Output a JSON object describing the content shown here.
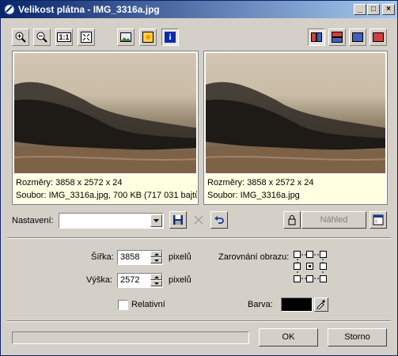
{
  "window": {
    "title": "Velikost plátna - IMG_3316a.jpg",
    "minimize": "_",
    "maximize": "□",
    "close": "×"
  },
  "toolbar": {
    "zoom_in": "zoom-in-icon",
    "zoom_out": "zoom-out-icon",
    "actual_size": "1:1",
    "fit": "fit-window-icon",
    "image": "image-icon",
    "sun": "brightness-icon",
    "info": "i",
    "layout_side": "split-vertical-icon",
    "layout_stack": "split-horizontal-icon",
    "view_original": "view-original-icon",
    "view_result": "view-result-icon"
  },
  "preview_left": {
    "dimensions": "Rozměry: 3858 x 2572 x 24",
    "file": "Soubor: IMG_3316a.jpg, 700 KB (717 031 bajtů"
  },
  "preview_right": {
    "dimensions": "Rozměry: 3858 x 2572 x 24",
    "file": "Soubor: IMG_3316a.jpg"
  },
  "settings": {
    "label": "Nastavení:",
    "value": ""
  },
  "preview_button": "Náhled",
  "size": {
    "width_label": "Šířka:",
    "width_value": "3858",
    "width_unit": "pixelů",
    "height_label": "Výška:",
    "height_value": "2572",
    "height_unit": "pixelů",
    "relative_label": "Relativní",
    "relative_checked": false
  },
  "anchor": {
    "label": "Zarovnání obrazu:",
    "selected": "center"
  },
  "color": {
    "label": "Barva:",
    "value": "#000000"
  },
  "buttons": {
    "ok": "OK",
    "cancel": "Storno"
  },
  "progress": 0
}
